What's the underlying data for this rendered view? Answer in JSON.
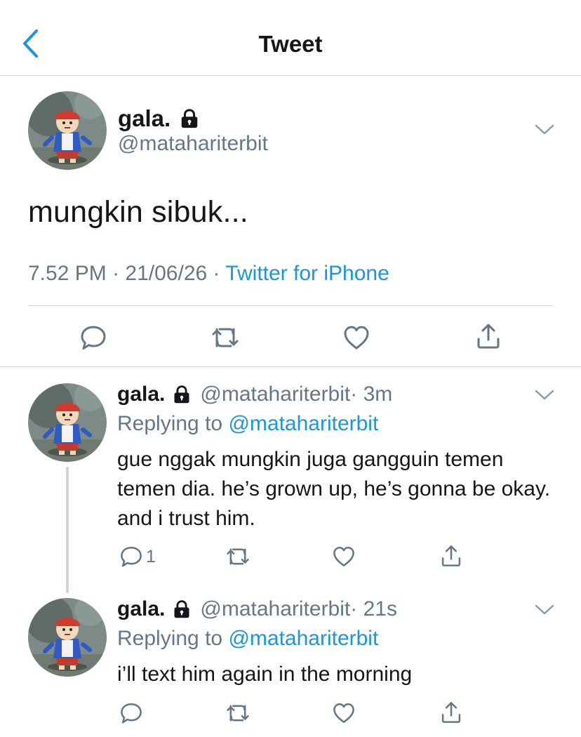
{
  "nav": {
    "title": "Tweet"
  },
  "main_tweet": {
    "name": "gala.",
    "handle": "@matahariterbit",
    "text": "mungkin sibuk...",
    "time": "7.52 PM",
    "sep1": " · ",
    "date": "21/06/26",
    "sep2": " · ",
    "source": "Twitter for iPhone"
  },
  "replies": [
    {
      "name": "gala.",
      "handle": "@matahariterbit",
      "age": " · 3m",
      "replying_prefix": "Replying to ",
      "replying_to": "@matahariterbit",
      "text": "gue nggak mungkin juga gangguin temen temen dia. he’s grown up, he’s gonna be okay. and i trust him.",
      "reply_count": "1"
    },
    {
      "name": "gala.",
      "handle": "@matahariterbit",
      "age": " · 21s",
      "replying_prefix": "Replying to ",
      "replying_to": "@matahariterbit",
      "text": "i’ll text him again in the morning",
      "reply_count": ""
    }
  ],
  "icons": [
    "back-chevron-icon",
    "lock-icon",
    "chevron-down-icon",
    "reply-icon",
    "retweet-icon",
    "like-icon",
    "share-icon"
  ],
  "colors": {
    "accent": "#1b95e0",
    "secondary_text": "#657786",
    "primary_text": "#14171a",
    "divider": "#d6d9db"
  }
}
